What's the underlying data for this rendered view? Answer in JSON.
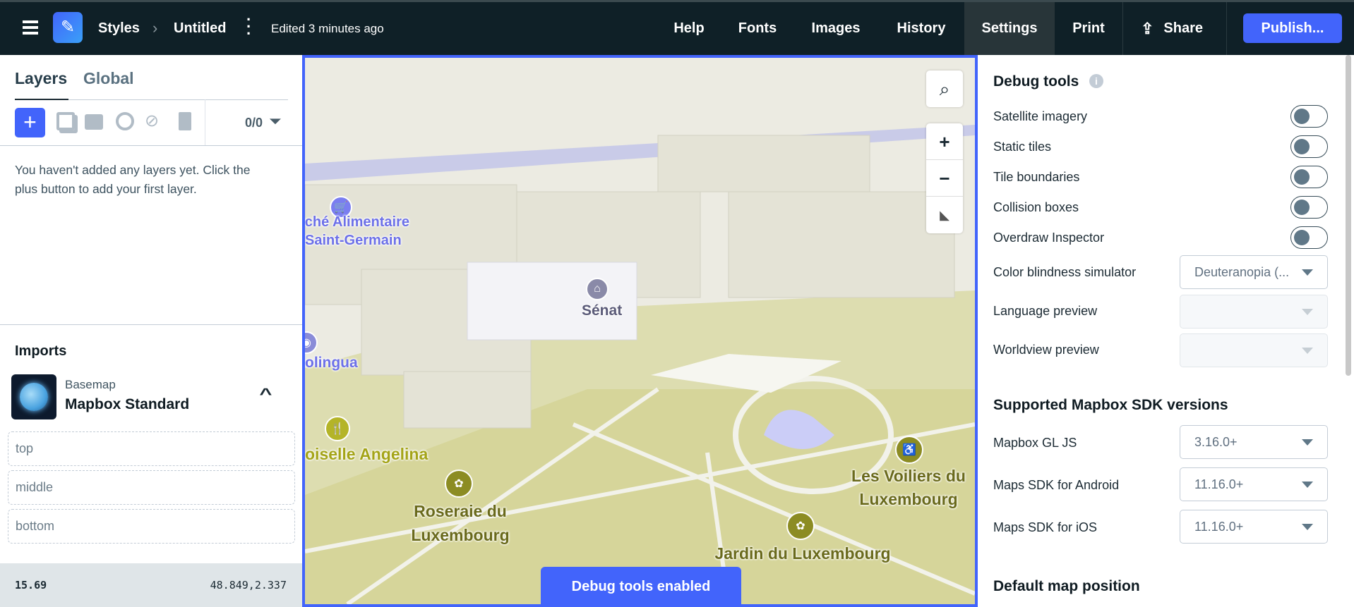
{
  "header": {
    "breadcrumb_root": "Styles",
    "breadcrumb_current": "Untitled",
    "edited": "Edited 3 minutes ago",
    "nav": [
      "Help",
      "Fonts",
      "Images",
      "History",
      "Settings",
      "Print"
    ],
    "share": "Share",
    "publish": "Publish...",
    "active": "Settings"
  },
  "left": {
    "tabs": [
      "Layers",
      "Global"
    ],
    "layer_count": "0/0",
    "empty_text": "You haven't added any layers yet. Click the plus button to add your first layer.",
    "imports_title": "Imports",
    "basemap_label": "Basemap",
    "basemap_name": "Mapbox Standard",
    "slots": [
      "top",
      "middle",
      "bottom"
    ],
    "zoom": "15.69",
    "coords": "48.849,2.337"
  },
  "map": {
    "labels": {
      "marche": "rché Alimentaire",
      "marche2": "Saint-Germain",
      "senat": "Sénat",
      "olingua": "olingua",
      "angelina": "oiselle Angelina",
      "roseraie": "Roseraie du",
      "roseraie2": "Luxembourg",
      "voiliers": "Les Voiliers du",
      "voiliers2": "Luxembourg",
      "jardin": "Jardin du Luxembourg"
    },
    "toast": "Debug tools enabled",
    "zoom_in": "+",
    "zoom_out": "−"
  },
  "right": {
    "debug_title": "Debug tools",
    "toggles": [
      {
        "label": "Satellite imagery",
        "on": false
      },
      {
        "label": "Static tiles",
        "on": false
      },
      {
        "label": "Tile boundaries",
        "on": false
      },
      {
        "label": "Collision boxes",
        "on": false
      },
      {
        "label": "Overdraw Inspector",
        "on": false
      }
    ],
    "color_blindness": {
      "label": "Color blindness simulator",
      "value": "Deuteranopia (..."
    },
    "language": {
      "label": "Language preview",
      "value": ""
    },
    "worldview": {
      "label": "Worldview preview",
      "value": ""
    },
    "sdk_title": "Supported Mapbox SDK versions",
    "sdk": [
      {
        "label": "Mapbox GL JS",
        "value": "3.16.0+"
      },
      {
        "label": "Maps SDK for Android",
        "value": "11.16.0+"
      },
      {
        "label": "Maps SDK for iOS",
        "value": "11.16.0+"
      }
    ],
    "default_pos_title": "Default map position"
  },
  "colors": {
    "accent": "#4264fb",
    "header": "#0f2027",
    "park": "#d9d8a0",
    "poi_green": "#8c8c23"
  }
}
